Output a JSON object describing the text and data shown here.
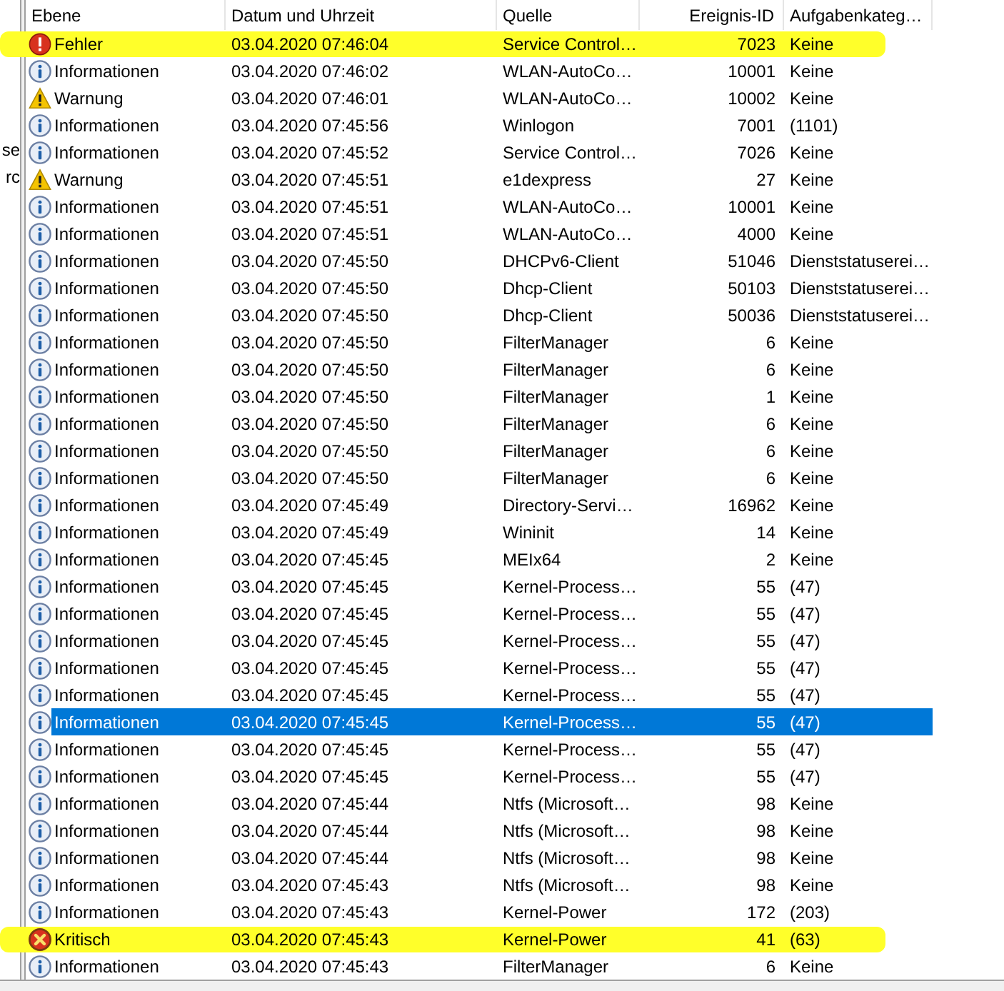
{
  "left_panel": {
    "items": [
      "se",
      "rc"
    ]
  },
  "table": {
    "columns": [
      "Ebene",
      "Datum und Uhrzeit",
      "Quelle",
      "Ereignis-ID",
      "Aufgabenkateg…"
    ],
    "rows": [
      {
        "kind": "error",
        "level": "Fehler",
        "date": "03.04.2020 07:46:04",
        "source": "Service Control…",
        "id": "7023",
        "category": "Keine",
        "selected": false,
        "highlighted": true
      },
      {
        "kind": "info",
        "level": "Informationen",
        "date": "03.04.2020 07:46:02",
        "source": "WLAN-AutoCo…",
        "id": "10001",
        "category": "Keine",
        "selected": false,
        "highlighted": false
      },
      {
        "kind": "warning",
        "level": "Warnung",
        "date": "03.04.2020 07:46:01",
        "source": "WLAN-AutoCo…",
        "id": "10002",
        "category": "Keine",
        "selected": false,
        "highlighted": false
      },
      {
        "kind": "info",
        "level": "Informationen",
        "date": "03.04.2020 07:45:56",
        "source": "Winlogon",
        "id": "7001",
        "category": "(1101)",
        "selected": false,
        "highlighted": false
      },
      {
        "kind": "info",
        "level": "Informationen",
        "date": "03.04.2020 07:45:52",
        "source": "Service Control…",
        "id": "7026",
        "category": "Keine",
        "selected": false,
        "highlighted": false
      },
      {
        "kind": "warning",
        "level": "Warnung",
        "date": "03.04.2020 07:45:51",
        "source": "e1dexpress",
        "id": "27",
        "category": "Keine",
        "selected": false,
        "highlighted": false
      },
      {
        "kind": "info",
        "level": "Informationen",
        "date": "03.04.2020 07:45:51",
        "source": "WLAN-AutoCo…",
        "id": "10001",
        "category": "Keine",
        "selected": false,
        "highlighted": false
      },
      {
        "kind": "info",
        "level": "Informationen",
        "date": "03.04.2020 07:45:51",
        "source": "WLAN-AutoCo…",
        "id": "4000",
        "category": "Keine",
        "selected": false,
        "highlighted": false
      },
      {
        "kind": "info",
        "level": "Informationen",
        "date": "03.04.2020 07:45:50",
        "source": "DHCPv6-Client",
        "id": "51046",
        "category": "Dienststatuserei…",
        "selected": false,
        "highlighted": false
      },
      {
        "kind": "info",
        "level": "Informationen",
        "date": "03.04.2020 07:45:50",
        "source": "Dhcp-Client",
        "id": "50103",
        "category": "Dienststatuserei…",
        "selected": false,
        "highlighted": false
      },
      {
        "kind": "info",
        "level": "Informationen",
        "date": "03.04.2020 07:45:50",
        "source": "Dhcp-Client",
        "id": "50036",
        "category": "Dienststatuserei…",
        "selected": false,
        "highlighted": false
      },
      {
        "kind": "info",
        "level": "Informationen",
        "date": "03.04.2020 07:45:50",
        "source": "FilterManager",
        "id": "6",
        "category": "Keine",
        "selected": false,
        "highlighted": false
      },
      {
        "kind": "info",
        "level": "Informationen",
        "date": "03.04.2020 07:45:50",
        "source": "FilterManager",
        "id": "6",
        "category": "Keine",
        "selected": false,
        "highlighted": false
      },
      {
        "kind": "info",
        "level": "Informationen",
        "date": "03.04.2020 07:45:50",
        "source": "FilterManager",
        "id": "1",
        "category": "Keine",
        "selected": false,
        "highlighted": false
      },
      {
        "kind": "info",
        "level": "Informationen",
        "date": "03.04.2020 07:45:50",
        "source": "FilterManager",
        "id": "6",
        "category": "Keine",
        "selected": false,
        "highlighted": false
      },
      {
        "kind": "info",
        "level": "Informationen",
        "date": "03.04.2020 07:45:50",
        "source": "FilterManager",
        "id": "6",
        "category": "Keine",
        "selected": false,
        "highlighted": false
      },
      {
        "kind": "info",
        "level": "Informationen",
        "date": "03.04.2020 07:45:50",
        "source": "FilterManager",
        "id": "6",
        "category": "Keine",
        "selected": false,
        "highlighted": false
      },
      {
        "kind": "info",
        "level": "Informationen",
        "date": "03.04.2020 07:45:49",
        "source": "Directory-Servi…",
        "id": "16962",
        "category": "Keine",
        "selected": false,
        "highlighted": false
      },
      {
        "kind": "info",
        "level": "Informationen",
        "date": "03.04.2020 07:45:49",
        "source": "Wininit",
        "id": "14",
        "category": "Keine",
        "selected": false,
        "highlighted": false
      },
      {
        "kind": "info",
        "level": "Informationen",
        "date": "03.04.2020 07:45:45",
        "source": "MEIx64",
        "id": "2",
        "category": "Keine",
        "selected": false,
        "highlighted": false
      },
      {
        "kind": "info",
        "level": "Informationen",
        "date": "03.04.2020 07:45:45",
        "source": "Kernel-Process…",
        "id": "55",
        "category": "(47)",
        "selected": false,
        "highlighted": false
      },
      {
        "kind": "info",
        "level": "Informationen",
        "date": "03.04.2020 07:45:45",
        "source": "Kernel-Process…",
        "id": "55",
        "category": "(47)",
        "selected": false,
        "highlighted": false
      },
      {
        "kind": "info",
        "level": "Informationen",
        "date": "03.04.2020 07:45:45",
        "source": "Kernel-Process…",
        "id": "55",
        "category": "(47)",
        "selected": false,
        "highlighted": false
      },
      {
        "kind": "info",
        "level": "Informationen",
        "date": "03.04.2020 07:45:45",
        "source": "Kernel-Process…",
        "id": "55",
        "category": "(47)",
        "selected": false,
        "highlighted": false
      },
      {
        "kind": "info",
        "level": "Informationen",
        "date": "03.04.2020 07:45:45",
        "source": "Kernel-Process…",
        "id": "55",
        "category": "(47)",
        "selected": false,
        "highlighted": false
      },
      {
        "kind": "info",
        "level": "Informationen",
        "date": "03.04.2020 07:45:45",
        "source": "Kernel-Process…",
        "id": "55",
        "category": "(47)",
        "selected": true,
        "highlighted": false
      },
      {
        "kind": "info",
        "level": "Informationen",
        "date": "03.04.2020 07:45:45",
        "source": "Kernel-Process…",
        "id": "55",
        "category": "(47)",
        "selected": false,
        "highlighted": false
      },
      {
        "kind": "info",
        "level": "Informationen",
        "date": "03.04.2020 07:45:45",
        "source": "Kernel-Process…",
        "id": "55",
        "category": "(47)",
        "selected": false,
        "highlighted": false
      },
      {
        "kind": "info",
        "level": "Informationen",
        "date": "03.04.2020 07:45:44",
        "source": "Ntfs (Microsoft…",
        "id": "98",
        "category": "Keine",
        "selected": false,
        "highlighted": false
      },
      {
        "kind": "info",
        "level": "Informationen",
        "date": "03.04.2020 07:45:44",
        "source": "Ntfs (Microsoft…",
        "id": "98",
        "category": "Keine",
        "selected": false,
        "highlighted": false
      },
      {
        "kind": "info",
        "level": "Informationen",
        "date": "03.04.2020 07:45:44",
        "source": "Ntfs (Microsoft…",
        "id": "98",
        "category": "Keine",
        "selected": false,
        "highlighted": false
      },
      {
        "kind": "info",
        "level": "Informationen",
        "date": "03.04.2020 07:45:43",
        "source": "Ntfs (Microsoft…",
        "id": "98",
        "category": "Keine",
        "selected": false,
        "highlighted": false
      },
      {
        "kind": "info",
        "level": "Informationen",
        "date": "03.04.2020 07:45:43",
        "source": "Kernel-Power",
        "id": "172",
        "category": "(203)",
        "selected": false,
        "highlighted": false
      },
      {
        "kind": "critical",
        "level": "Kritisch",
        "date": "03.04.2020 07:45:43",
        "source": "Kernel-Power",
        "id": "41",
        "category": "(63)",
        "selected": false,
        "highlighted": true
      },
      {
        "kind": "info",
        "level": "Informationen",
        "date": "03.04.2020 07:45:43",
        "source": "FilterManager",
        "id": "6",
        "category": "Keine",
        "selected": false,
        "highlighted": false
      }
    ]
  }
}
